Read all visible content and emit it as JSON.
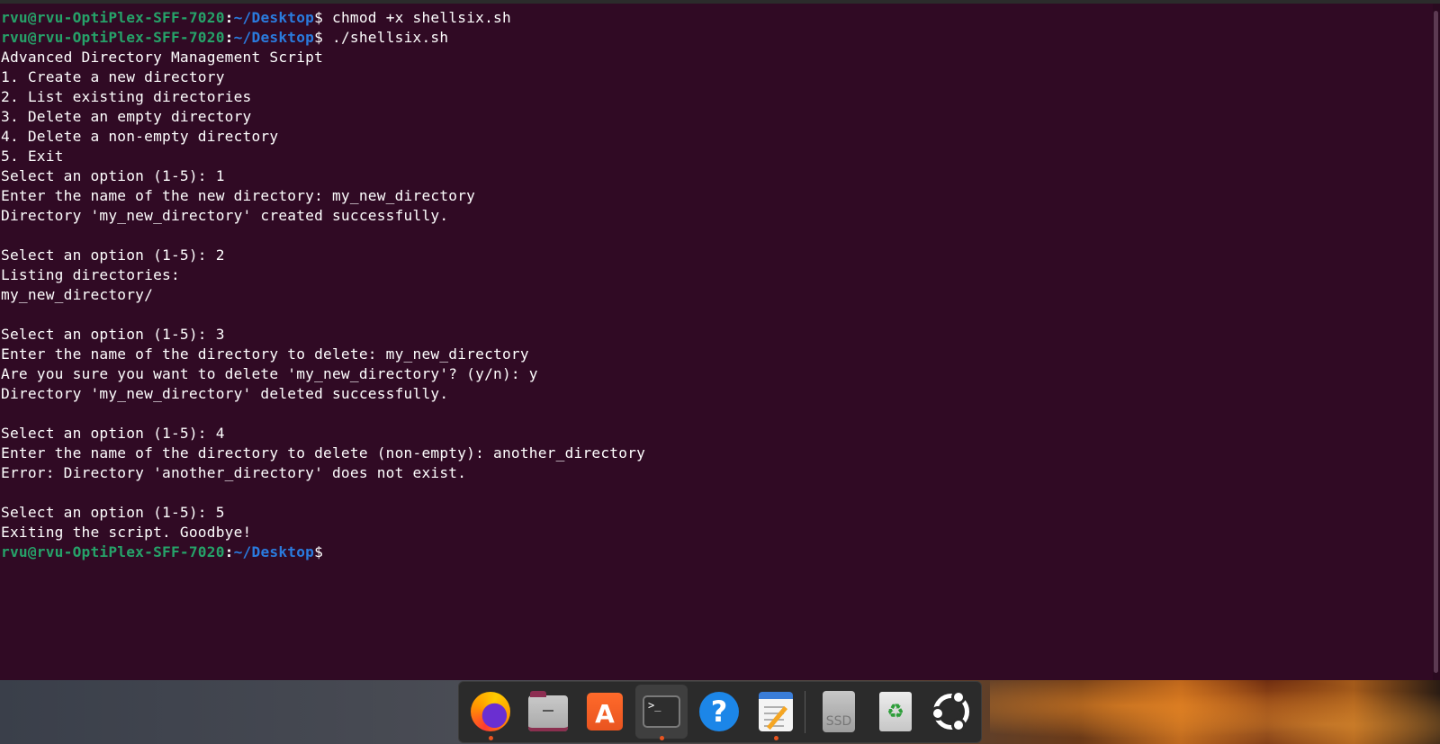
{
  "terminal": {
    "prompt": {
      "user_host": "rvu@rvu-OptiPlex-SFF-7020",
      "colon": ":",
      "path": "~/Desktop",
      "dollar": "$"
    },
    "lines": [
      {
        "kind": "prompt",
        "command": " chmod +x shellsix.sh"
      },
      {
        "kind": "prompt",
        "command": " ./shellsix.sh"
      },
      {
        "kind": "text",
        "text": "Advanced Directory Management Script"
      },
      {
        "kind": "text",
        "text": "1. Create a new directory"
      },
      {
        "kind": "text",
        "text": "2. List existing directories"
      },
      {
        "kind": "text",
        "text": "3. Delete an empty directory"
      },
      {
        "kind": "text",
        "text": "4. Delete a non-empty directory"
      },
      {
        "kind": "text",
        "text": "5. Exit"
      },
      {
        "kind": "text",
        "text": "Select an option (1-5): 1"
      },
      {
        "kind": "text",
        "text": "Enter the name of the new directory: my_new_directory"
      },
      {
        "kind": "text",
        "text": "Directory 'my_new_directory' created successfully."
      },
      {
        "kind": "text",
        "text": ""
      },
      {
        "kind": "text",
        "text": "Select an option (1-5): 2"
      },
      {
        "kind": "text",
        "text": "Listing directories:"
      },
      {
        "kind": "text",
        "text": "my_new_directory/"
      },
      {
        "kind": "text",
        "text": ""
      },
      {
        "kind": "text",
        "text": "Select an option (1-5): 3"
      },
      {
        "kind": "text",
        "text": "Enter the name of the directory to delete: my_new_directory"
      },
      {
        "kind": "text",
        "text": "Are you sure you want to delete 'my_new_directory'? (y/n): y"
      },
      {
        "kind": "text",
        "text": "Directory 'my_new_directory' deleted successfully."
      },
      {
        "kind": "text",
        "text": ""
      },
      {
        "kind": "text",
        "text": "Select an option (1-5): 4"
      },
      {
        "kind": "text",
        "text": "Enter the name of the directory to delete (non-empty): another_directory"
      },
      {
        "kind": "text",
        "text": "Error: Directory 'another_directory' does not exist."
      },
      {
        "kind": "text",
        "text": ""
      },
      {
        "kind": "text",
        "text": "Select an option (1-5): 5"
      },
      {
        "kind": "text",
        "text": "Exiting the script. Goodbye!"
      },
      {
        "kind": "prompt",
        "command": ""
      }
    ],
    "colors": {
      "background": "#300a24",
      "prompt_user": "#26a269",
      "prompt_path": "#2a7bde",
      "text": "#ffffff"
    }
  },
  "dock": {
    "items": [
      {
        "name": "firefox",
        "icon": "firefox-icon",
        "running": true,
        "active": false
      },
      {
        "name": "files",
        "icon": "folder-icon",
        "running": false,
        "active": false
      },
      {
        "name": "app-center",
        "icon": "shopping-bag-icon",
        "glyph": "A",
        "running": false,
        "active": false
      },
      {
        "name": "terminal",
        "icon": "terminal-icon",
        "glyph": ">_",
        "running": true,
        "active": true
      },
      {
        "name": "help",
        "icon": "help-icon",
        "glyph": "?",
        "running": false,
        "active": false
      },
      {
        "name": "text-editor",
        "icon": "text-editor-icon",
        "running": true,
        "active": false
      },
      {
        "name": "ssd-drive",
        "icon": "drive-icon",
        "glyph": "SSD",
        "running": false,
        "active": false
      },
      {
        "name": "trash",
        "icon": "trash-icon",
        "glyph": "♻",
        "running": false,
        "active": false
      },
      {
        "name": "show-apps",
        "icon": "ubuntu-logo-icon",
        "running": false,
        "active": false
      }
    ],
    "colors": {
      "running_indicator": "#e95420"
    }
  }
}
